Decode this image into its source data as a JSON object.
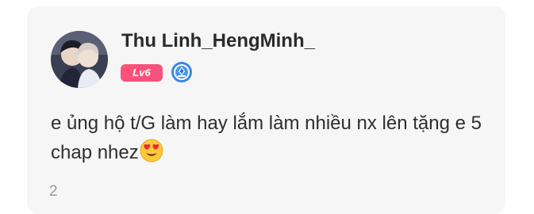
{
  "comment": {
    "author": {
      "avatar_icon": "avatar-photo",
      "name": "Thu Linh_HengMinh_",
      "level_badge": "Lv6",
      "verified_icon": "verified-badge-icon"
    },
    "body_text": "e ủng hộ t/G làm hay lắm làm nhiều nx lên tặng e 5 chap nhez",
    "emoji_icon": "heart-eyes-emoji",
    "count": "2"
  },
  "colors": {
    "card_background": "#f6f6f6",
    "level_badge": "#f2527b",
    "verified_badge": "#3a86e8",
    "text": "#2e2e2e",
    "muted": "#9a9a9a"
  }
}
